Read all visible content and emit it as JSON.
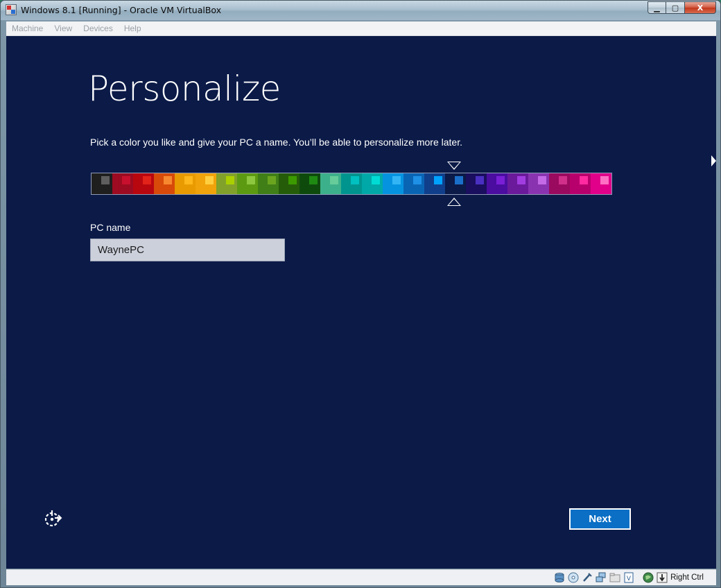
{
  "window": {
    "title": "Windows 8.1 [Running] - Oracle VM VirtualBox",
    "controls": {
      "minimize": "▁",
      "maximize": "▢",
      "close": "X"
    }
  },
  "menubar": {
    "items": [
      {
        "label": "Machine"
      },
      {
        "label": "View"
      },
      {
        "label": "Devices"
      },
      {
        "label": "Help"
      }
    ]
  },
  "screen": {
    "background": "#0b1a47",
    "heading": "Personalize",
    "subtitle": "Pick a color you like and give your PC a name. You’ll be able to personalize more later.",
    "palette": {
      "selected_index": 17,
      "swatches": [
        {
          "bg": "#1f1f1f",
          "accent": "#5e5e5e"
        },
        {
          "bg": "#9c0b21",
          "accent": "#c8102e"
        },
        {
          "bg": "#b8070f",
          "accent": "#e2231a"
        },
        {
          "bg": "#d84a09",
          "accent": "#f7882f"
        },
        {
          "bg": "#e89a00",
          "accent": "#ffb71b"
        },
        {
          "bg": "#f0a30a",
          "accent": "#ffcf3f"
        },
        {
          "bg": "#82a12b",
          "accent": "#aad000"
        },
        {
          "bg": "#5c9a12",
          "accent": "#8dc63f"
        },
        {
          "bg": "#407e17",
          "accent": "#6ba520"
        },
        {
          "bg": "#255c0a",
          "accent": "#3c9a00"
        },
        {
          "bg": "#0f4a0d",
          "accent": "#1f8a12"
        },
        {
          "bg": "#3cb08a",
          "accent": "#66cc99"
        },
        {
          "bg": "#00948f",
          "accent": "#00c0c0"
        },
        {
          "bg": "#00a9a8",
          "accent": "#00dcd5"
        },
        {
          "bg": "#0593e0",
          "accent": "#33b5f5"
        },
        {
          "bg": "#0a64b4",
          "accent": "#1e90e6"
        },
        {
          "bg": "#103e8a",
          "accent": "#00a2ff"
        },
        {
          "bg": "#0b1a47",
          "accent": "#1a6fc9"
        },
        {
          "bg": "#1a0e5e",
          "accent": "#4a2fc2"
        },
        {
          "bg": "#4a0da0",
          "accent": "#7a1fd6"
        },
        {
          "bg": "#6a1a9a",
          "accent": "#a13de0"
        },
        {
          "bg": "#8a33b0",
          "accent": "#c46ae6"
        },
        {
          "bg": "#9a0a5e",
          "accent": "#d0308a"
        },
        {
          "bg": "#b8006c",
          "accent": "#ff2aa0"
        },
        {
          "bg": "#e1008a",
          "accent": "#ff70c4"
        }
      ]
    },
    "pc_name_label": "PC name",
    "pc_name_value": "WaynePC",
    "next_label": "Next"
  },
  "statusbar": {
    "icons": [
      "hard-disk-icon",
      "optical-drive-icon",
      "usb-icon",
      "network-icon",
      "shared-folder-icon",
      "display-icon",
      "globe-icon",
      "mouse-integration-icon"
    ],
    "host_key": "Right Ctrl"
  }
}
